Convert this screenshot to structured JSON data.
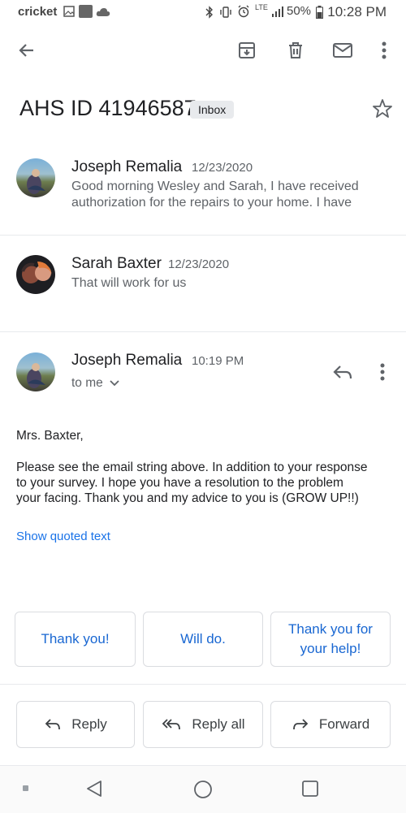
{
  "status_bar": {
    "carrier": "cricket",
    "signal": "LTE",
    "battery": "50%",
    "time": "10:28 PM"
  },
  "toolbar": {
    "icons": [
      "back-arrow-icon",
      "archive-icon",
      "trash-icon",
      "mail-icon",
      "more-vert-icon"
    ]
  },
  "thread": {
    "subject": "AHS ID 41946587",
    "label": "Inbox"
  },
  "messages": [
    {
      "sender": "Joseph Remalia",
      "date": "12/23/2020",
      "snippet_line1": "Good morning Wesley and Sarah, I have received",
      "snippet_line2": "authorization for the repairs to your home. I have"
    },
    {
      "sender": "Sarah Baxter",
      "date": "12/23/2020",
      "snippet_line1": "That will work for us"
    },
    {
      "sender": "Joseph Remalia",
      "date": "10:19 PM",
      "recipient": "to me"
    }
  ],
  "open_message": {
    "greeting": "Mrs. Baxter,",
    "body_line1": "Please see the email string above. In addition to your response",
    "body_line2": "to your survey. I hope you have a resolution to the problem",
    "body_line3": "your facing. Thank you and my advice to you is (GROW UP!!)",
    "show_quoted": "Show quoted text"
  },
  "smart_replies": {
    "r1": "Thank you!",
    "r2": "Will do.",
    "r3_line1": "Thank you for",
    "r3_line2": "your help!"
  },
  "actions": {
    "reply": "Reply",
    "reply_all": "Reply all",
    "forward": "Forward"
  },
  "colors": {
    "accent": "#1a73e8",
    "text": "#202124",
    "secondary": "#5f6368"
  }
}
